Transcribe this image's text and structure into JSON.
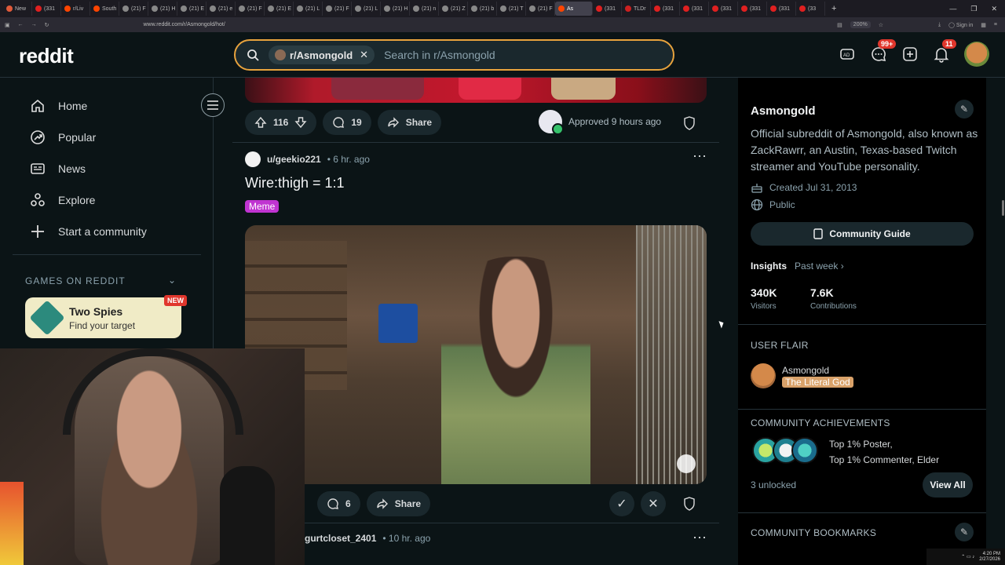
{
  "browser": {
    "tabs": [
      {
        "label": "New",
        "color": "#e05a3a"
      },
      {
        "label": "(331",
        "color": "#e02020"
      },
      {
        "label": "r/Liv",
        "color": "#ff4500"
      },
      {
        "label": "South",
        "color": "#ff4500"
      },
      {
        "label": "(21) F",
        "color": "#888888"
      },
      {
        "label": "(21) H",
        "color": "#888888"
      },
      {
        "label": "(21) E",
        "color": "#888888"
      },
      {
        "label": "(21) e",
        "color": "#888888"
      },
      {
        "label": "(21) F",
        "color": "#888888"
      },
      {
        "label": "(21) E",
        "color": "#888888"
      },
      {
        "label": "(21) L",
        "color": "#888888"
      },
      {
        "label": "(21) F",
        "color": "#888888"
      },
      {
        "label": "(21) L",
        "color": "#888888"
      },
      {
        "label": "(21) H",
        "color": "#888888"
      },
      {
        "label": "(21) n",
        "color": "#888888"
      },
      {
        "label": "(21) Z",
        "color": "#888888"
      },
      {
        "label": "(21) b",
        "color": "#888888"
      },
      {
        "label": "(21) T",
        "color": "#888888"
      },
      {
        "label": "(21) F",
        "color": "#888888"
      },
      {
        "label": "As",
        "color": "#ff4500",
        "active": true
      },
      {
        "label": "(331",
        "color": "#e02020"
      },
      {
        "label": "TLDr",
        "color": "#cc2020"
      },
      {
        "label": "(331",
        "color": "#e02020"
      },
      {
        "label": "(331",
        "color": "#e02020"
      },
      {
        "label": "(331",
        "color": "#e02020"
      },
      {
        "label": "(331",
        "color": "#e02020"
      },
      {
        "label": "(331",
        "color": "#e02020"
      },
      {
        "label": "(33",
        "color": "#e02020"
      }
    ],
    "url": "www.reddit.com/r/Asmongold/hot/",
    "zoom": "200%",
    "sign_in": "Sign in"
  },
  "header": {
    "logo": "reddit",
    "search_chip": "r/Asmongold",
    "search_placeholder": "Search in r/Asmongold",
    "chat_badge": "99+",
    "notif_badge": "11"
  },
  "leftnav": {
    "items": [
      "Home",
      "Popular",
      "News",
      "Explore",
      "Start a community"
    ],
    "games_heading": "GAMES ON REDDIT",
    "game": {
      "title": "Two Spies",
      "subtitle": "Find your target",
      "badge": "NEW"
    }
  },
  "feed": {
    "post1": {
      "upvotes": "116",
      "comments": "19",
      "share": "Share",
      "approved": "Approved 9 hours ago"
    },
    "post2": {
      "author": "u/geekio221",
      "time": "• 6 hr. ago",
      "title": "Wire:thigh = 1:1",
      "flair": "Meme",
      "comments": "6",
      "share": "Share"
    },
    "post3": {
      "author": "gurtcloset_2401",
      "time": "• 10 hr. ago"
    }
  },
  "sidebar": {
    "title": "Asmongold",
    "description": "Official subreddit of Asmongold, also known as ZackRawrr, an Austin, Texas-based Twitch streamer and YouTube personality.",
    "created": "Created Jul 31, 2013",
    "visibility": "Public",
    "guide_button": "Community Guide",
    "insights_label": "Insights",
    "insights_range": "Past week",
    "visitors_value": "340K",
    "visitors_label": "Visitors",
    "contrib_value": "7.6K",
    "contrib_label": "Contributions",
    "user_flair_heading": "USER FLAIR",
    "flair_user": "Asmongold",
    "flair_text": "The Literal God",
    "achievements_heading": "COMMUNITY ACHIEVEMENTS",
    "achievement_line1": "Top 1% Poster,",
    "achievement_line2": "Top 1% Commenter, Elder",
    "unlocked": "3 unlocked",
    "view_all": "View All",
    "bookmarks_heading": "COMMUNITY BOOKMARKS"
  },
  "taskbar": {
    "time": "4:20 PM",
    "date": "2/27/2026"
  }
}
